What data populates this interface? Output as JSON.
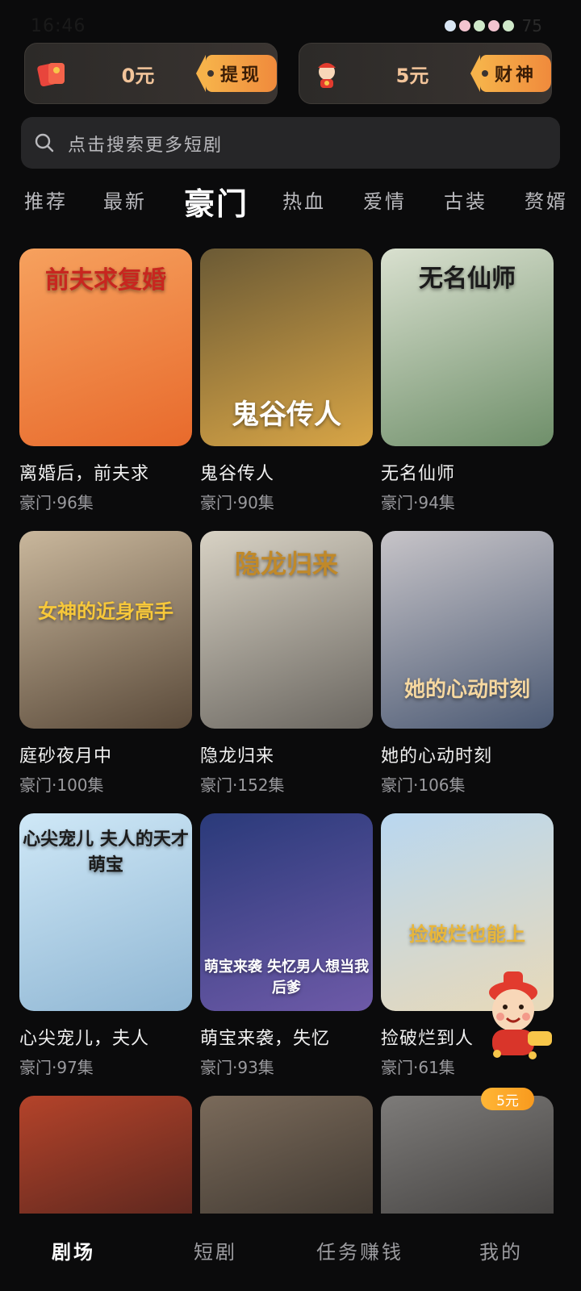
{
  "status_bar": {
    "time": "16:46",
    "battery": "75"
  },
  "money": {
    "left": {
      "value": "0元",
      "button": "提现",
      "icon": "red-envelope-icon"
    },
    "right": {
      "value": "5元",
      "button": "财神",
      "icon": "fortune-god-icon"
    }
  },
  "search": {
    "placeholder": "点击搜索更多短剧"
  },
  "tabs": [
    {
      "label": "推荐"
    },
    {
      "label": "最新"
    },
    {
      "label": "豪门",
      "active": true
    },
    {
      "label": "热血"
    },
    {
      "label": "爱情"
    },
    {
      "label": "古装"
    },
    {
      "label": "赘婿"
    }
  ],
  "dramas": [
    {
      "title": "离婚后，前夫求",
      "meta": "豪门·96集",
      "poster_text": "前夫求复婚",
      "colors": [
        "#f6a15e",
        "#e86a2c"
      ],
      "text_color": "#c8261f"
    },
    {
      "title": "鬼谷传人",
      "meta": "豪门·90集",
      "poster_text": "鬼谷传人",
      "colors": [
        "#6b5a35",
        "#d8a546"
      ],
      "text_color": "#ffffff"
    },
    {
      "title": "无名仙师",
      "meta": "豪门·94集",
      "poster_text": "无名仙师",
      "colors": [
        "#d9e0cf",
        "#6f8f6a"
      ],
      "text_color": "#1b1b1b"
    },
    {
      "title": "庭砂夜月中",
      "meta": "豪门·100集",
      "poster_text": "女神的近身高手",
      "colors": [
        "#c9b79c",
        "#5a4a3a"
      ],
      "text_color": "#f7c83a"
    },
    {
      "title": "隐龙归来",
      "meta": "豪门·152集",
      "poster_text": "隐龙归来",
      "colors": [
        "#d8d2c4",
        "#6a6660"
      ],
      "text_color": "#c0892a"
    },
    {
      "title": "她的心动时刻",
      "meta": "豪门·106集",
      "poster_text": "她的心动时刻",
      "colors": [
        "#c7c4c8",
        "#4c5a74"
      ],
      "text_color": "#f6d8a0"
    },
    {
      "title": "心尖宠儿，夫人",
      "meta": "豪门·97集",
      "poster_text": "心尖宠儿 夫人的天才萌宝",
      "colors": [
        "#cfe8f7",
        "#8fb6d3"
      ],
      "text_color": "#1b1b1b"
    },
    {
      "title": "萌宝来袭，失忆",
      "meta": "豪门·93集",
      "poster_text": "萌宝来袭 失忆男人想当我后爹",
      "colors": [
        "#2a3a7a",
        "#6e5aa8"
      ],
      "text_color": "#ffffff"
    },
    {
      "title": "捡破烂到人",
      "meta": "豪门·61集",
      "poster_text": "捡破烂也能上",
      "colors": [
        "#b9d7f0",
        "#e8d9b8"
      ],
      "text_color": "#e8b63a"
    },
    {
      "title": "",
      "meta": "",
      "poster_text": "",
      "colors": [
        "#b4432a",
        "#3a1c1a"
      ],
      "text_color": "#ffffff"
    },
    {
      "title": "",
      "meta": "",
      "poster_text": "",
      "colors": [
        "#7a6a5a",
        "#2a2622"
      ],
      "text_color": "#ffffff"
    },
    {
      "title": "",
      "meta": "",
      "poster_text": "",
      "colors": [
        "#7d7b79",
        "#2e2c2b"
      ],
      "text_color": "#ffffff"
    }
  ],
  "floating_badge": "5元",
  "bottom_nav": [
    {
      "label": "剧场",
      "active": true
    },
    {
      "label": "短剧"
    },
    {
      "label": "任务赚钱"
    },
    {
      "label": "我的"
    }
  ]
}
